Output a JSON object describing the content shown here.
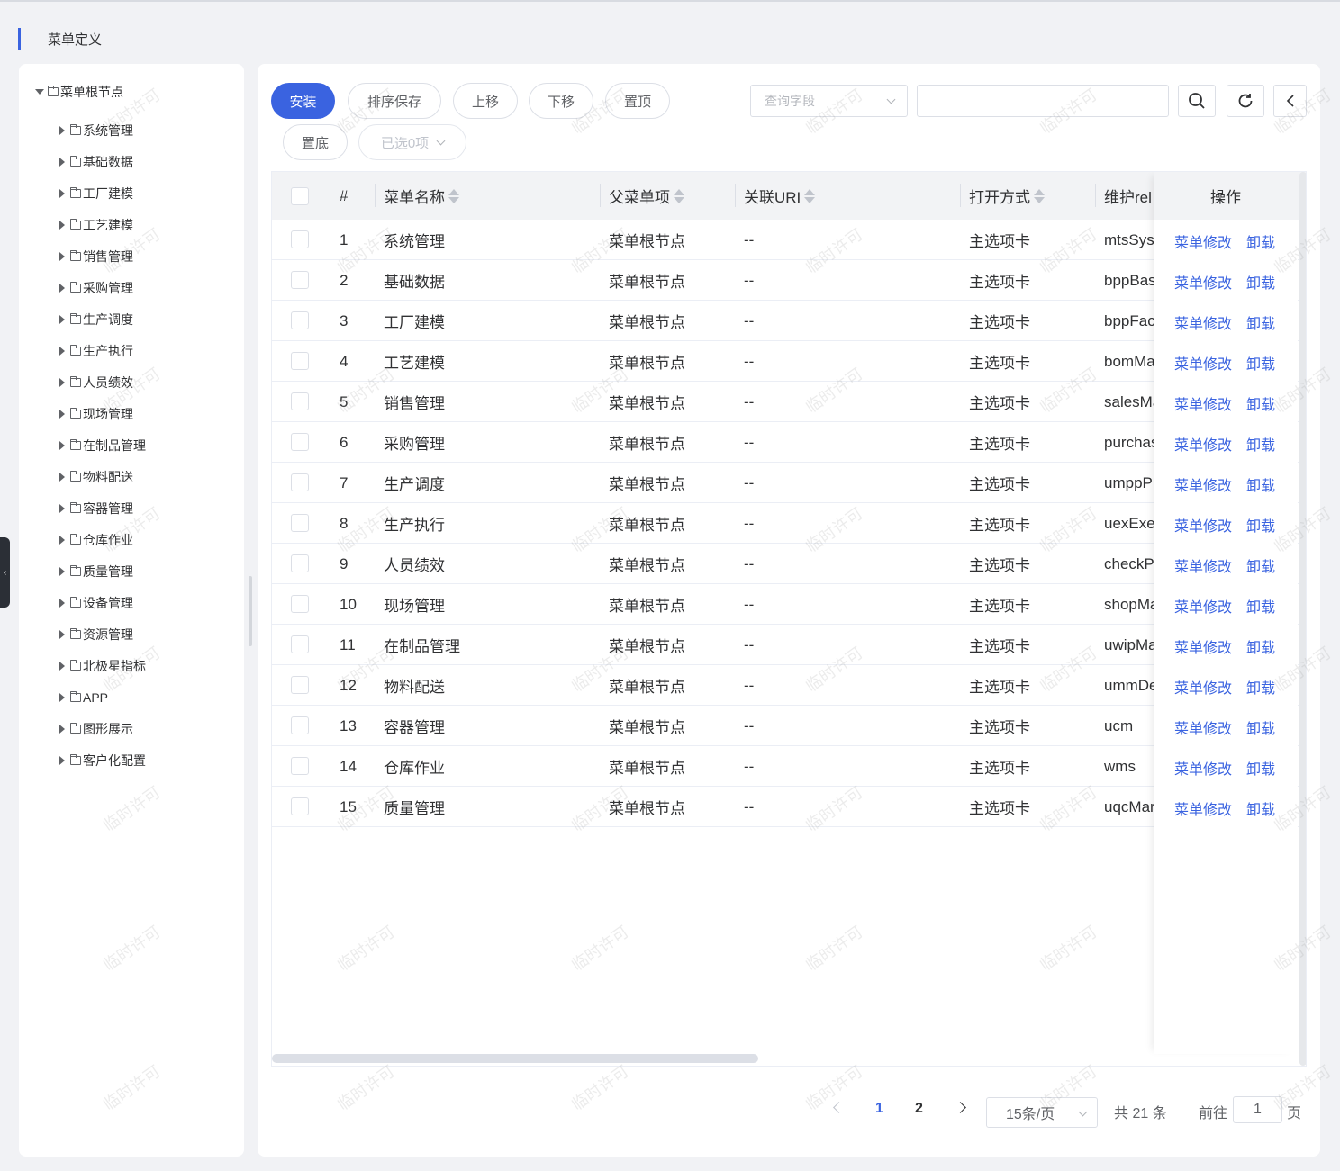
{
  "page": {
    "title": "菜单定义"
  },
  "tree": {
    "root": "菜单根节点",
    "items": [
      "系统管理",
      "基础数据",
      "工厂建模",
      "工艺建模",
      "销售管理",
      "采购管理",
      "生产调度",
      "生产执行",
      "人员绩效",
      "现场管理",
      "在制品管理",
      "物料配送",
      "容器管理",
      "仓库作业",
      "质量管理",
      "设备管理",
      "资源管理",
      "北极星指标",
      "APP",
      "图形展示",
      "客户化配置"
    ]
  },
  "toolbar": {
    "install": "安装",
    "save_sort": "排序保存",
    "move_up": "上移",
    "move_down": "下移",
    "to_top": "置顶",
    "to_bottom": "置底",
    "selected": "已选0项",
    "query_field_placeholder": "查询字段",
    "search_value": ""
  },
  "table": {
    "columns": {
      "index": "#",
      "name": "菜单名称",
      "parent": "父菜单项",
      "uri": "关联URI",
      "open_mode": "打开方式",
      "maintain": "维护rel",
      "ops": "操作"
    },
    "op_edit": "菜单修改",
    "op_uninstall": "卸载",
    "rows": [
      {
        "index": "1",
        "name": "系统管理",
        "parent": "菜单根节点",
        "uri": "--",
        "open_mode": "主选项卡",
        "maintain": "mtsSyst"
      },
      {
        "index": "2",
        "name": "基础数据",
        "parent": "菜单根节点",
        "uri": "--",
        "open_mode": "主选项卡",
        "maintain": "bppBas"
      },
      {
        "index": "3",
        "name": "工厂建模",
        "parent": "菜单根节点",
        "uri": "--",
        "open_mode": "主选项卡",
        "maintain": "bppFac"
      },
      {
        "index": "4",
        "name": "工艺建模",
        "parent": "菜单根节点",
        "uri": "--",
        "open_mode": "主选项卡",
        "maintain": "bomMa"
      },
      {
        "index": "5",
        "name": "销售管理",
        "parent": "菜单根节点",
        "uri": "--",
        "open_mode": "主选项卡",
        "maintain": "salesMa"
      },
      {
        "index": "6",
        "name": "采购管理",
        "parent": "菜单根节点",
        "uri": "--",
        "open_mode": "主选项卡",
        "maintain": "purchas"
      },
      {
        "index": "7",
        "name": "生产调度",
        "parent": "菜单根节点",
        "uri": "--",
        "open_mode": "主选项卡",
        "maintain": "umppP"
      },
      {
        "index": "8",
        "name": "生产执行",
        "parent": "菜单根节点",
        "uri": "--",
        "open_mode": "主选项卡",
        "maintain": "uexExe"
      },
      {
        "index": "9",
        "name": "人员绩效",
        "parent": "菜单根节点",
        "uri": "--",
        "open_mode": "主选项卡",
        "maintain": "checkP"
      },
      {
        "index": "10",
        "name": "现场管理",
        "parent": "菜单根节点",
        "uri": "--",
        "open_mode": "主选项卡",
        "maintain": "shopMa"
      },
      {
        "index": "11",
        "name": "在制品管理",
        "parent": "菜单根节点",
        "uri": "--",
        "open_mode": "主选项卡",
        "maintain": "uwipMa"
      },
      {
        "index": "12",
        "name": "物料配送",
        "parent": "菜单根节点",
        "uri": "--",
        "open_mode": "主选项卡",
        "maintain": "ummDe"
      },
      {
        "index": "13",
        "name": "容器管理",
        "parent": "菜单根节点",
        "uri": "--",
        "open_mode": "主选项卡",
        "maintain": "ucm"
      },
      {
        "index": "14",
        "name": "仓库作业",
        "parent": "菜单根节点",
        "uri": "--",
        "open_mode": "主选项卡",
        "maintain": "wms"
      },
      {
        "index": "15",
        "name": "质量管理",
        "parent": "菜单根节点",
        "uri": "--",
        "open_mode": "主选项卡",
        "maintain": "uqcMar"
      }
    ]
  },
  "pagination": {
    "pages": [
      "1",
      "2"
    ],
    "current": "1",
    "page_size": "15条/页",
    "total": "共 21 条",
    "goto_label": "前往",
    "goto_value": "1",
    "page_unit": "页"
  },
  "watermark": "临时许可",
  "icons": {
    "search": "search-icon",
    "refresh": "refresh-icon",
    "collapse": "chevron-left-icon"
  },
  "colors": {
    "primary": "#3a63e0"
  }
}
